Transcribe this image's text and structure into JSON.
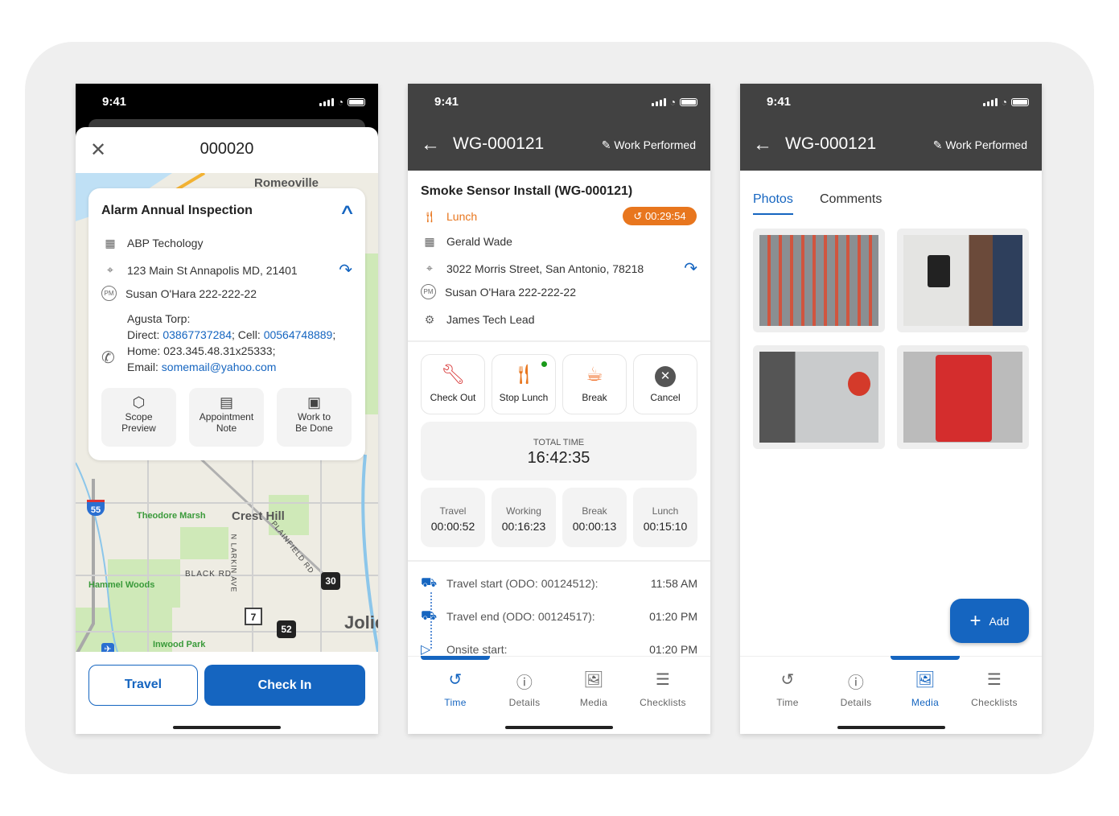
{
  "status_time": "9:41",
  "phone1": {
    "title": "000020",
    "map_labels": {
      "romeoville": "Romeoville",
      "crest_hill": "Crest Hill",
      "theodore_marsh": "Theodore Marsh",
      "hammel_woods": "Hammel Woods",
      "inwood_park": "Inwood Park",
      "black_rd": "BLACK RD",
      "larkin": "N LARKIN AVE",
      "plainfield": "PLAINFIELD RD",
      "joliet": "Jolie",
      "i55": "55",
      "us30": "30",
      "il7": "7",
      "us52": "52"
    },
    "card": {
      "title": "Alarm Annual Inspection",
      "company": "ABP Techology",
      "address": "123 Main St Annapolis MD, 21401",
      "pm": "Susan O'Hara 222-222-22",
      "contact": {
        "name": "Agusta Torp:",
        "direct_label": "Direct: ",
        "direct": "03867737284",
        "cell_label": "; Cell: ",
        "cell": "00564748889",
        "home": "Home: 023.345.48.31x25333;",
        "email_label": "Email: ",
        "email": "somemail@yahoo.com"
      },
      "actions": [
        {
          "l1": "Scope",
          "l2": "Preview",
          "icon": "layers-icon"
        },
        {
          "l1": "Appointment",
          "l2": "Note",
          "icon": "calendar-note-icon"
        },
        {
          "l1": "Work to",
          "l2": "Be Done",
          "icon": "toolbox-icon"
        }
      ]
    },
    "travel": "Travel",
    "check_in": "Check In"
  },
  "wo": {
    "number": "WG-000121",
    "work_performed": "Work Performed"
  },
  "phone2": {
    "title": "Smoke Sensor Install (WG-000121)",
    "status": "Lunch",
    "timer": "00:29:54",
    "tech": "Gerald  Wade",
    "address": "3022 Morris Street, San Antonio, 78218",
    "pm": "Susan O'Hara 222-222-22",
    "lead": "James Tech Lead",
    "actions": [
      "Check Out",
      "Stop Lunch",
      "Break",
      "Cancel"
    ],
    "total_label": "TOTAL TIME",
    "total": "16:42:35",
    "stats": [
      {
        "l": "Travel",
        "v": "00:00:52"
      },
      {
        "l": "Working",
        "v": "00:16:23"
      },
      {
        "l": "Break",
        "v": "00:00:13"
      },
      {
        "l": "Lunch",
        "v": "00:15:10"
      }
    ],
    "timeline": [
      {
        "l": "Travel start (ODO: 00124512):",
        "t": "11:58 AM"
      },
      {
        "l": "Travel end (ODO: 00124517):",
        "t": "01:20 PM"
      },
      {
        "l": "Onsite start:",
        "t": "01:20 PM"
      }
    ]
  },
  "phone3": {
    "tabs": [
      "Photos",
      "Comments"
    ],
    "add": "Add"
  },
  "tabs": [
    "Time",
    "Details",
    "Media",
    "Checklists"
  ],
  "colors": {
    "primary": "#1565c0",
    "orange": "#e8761e",
    "header": "#424242"
  }
}
